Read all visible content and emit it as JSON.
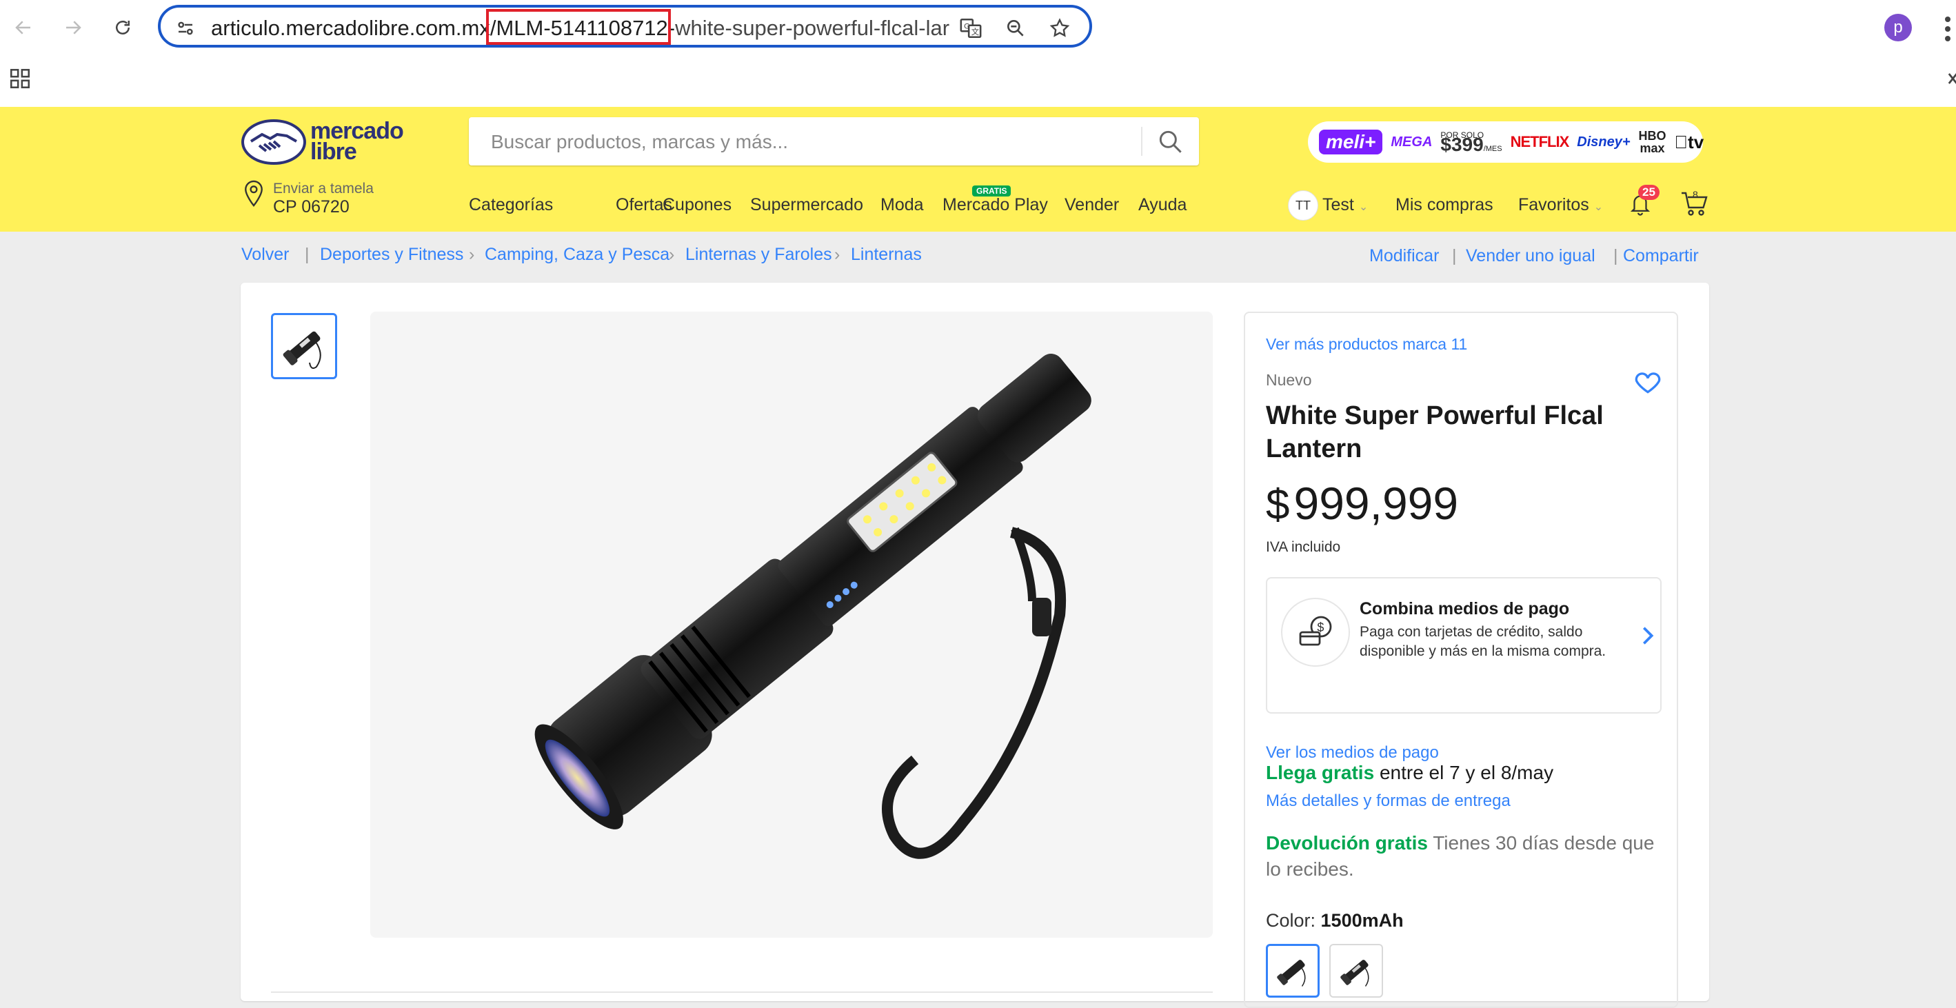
{
  "browser": {
    "url_domain": "articulo.mercadolibre.com.mx",
    "url_highlighted": "/MLM-5141108712-",
    "url_rest": "white-super-powerful-flcal-lar",
    "profile_initial": "p"
  },
  "header": {
    "logo_line1": "mercado",
    "logo_line2": "libre",
    "search_placeholder": "Buscar productos, marcas y más...",
    "promo": {
      "meli": "meli+",
      "mega": "MEGA",
      "por_solo": "POR SOLO",
      "price": "$399",
      "per": "/MES",
      "brands": [
        "NETFLIX",
        "Disney+",
        "HBO max",
        "tv"
      ]
    },
    "location_label": "Enviar a tamela",
    "location_value": "CP 06720",
    "nav": [
      "Categorías",
      "Ofertas",
      "Cupones",
      "Supermercado",
      "Moda",
      "Mercado Play",
      "Vender",
      "Ayuda"
    ],
    "gratis_badge": "GRATIS",
    "user_initials": "TT",
    "user_name": "Test",
    "my_purchases": "Mis compras",
    "favorites": "Favoritos",
    "notifications_count": "25",
    "cart_count": "8"
  },
  "breadcrumb": {
    "back": "Volver",
    "items": [
      "Deportes y Fitness",
      "Camping, Caza y Pesca",
      "Linternas y Faroles",
      "Linternas"
    ],
    "actions": [
      "Modificar",
      "Vender uno igual",
      "Compartir"
    ]
  },
  "product": {
    "brand_link": "Ver más productos marca 11",
    "condition": "Nuevo",
    "title": "White Super Powerful Flcal Lantern",
    "currency": "$",
    "price": "999,999",
    "tax": "IVA incluido",
    "payment": {
      "title": "Combina medios de pago",
      "subtitle": "Paga con tarjetas de crédito, saldo disponible y más en la misma compra."
    },
    "payment_link": "Ver los medios de pago",
    "shipping_green": "Llega gratis",
    "shipping_rest": " entre el 7 y el 8/may",
    "shipping_link": "Más detalles y formas de entrega",
    "return_green": "Devolución gratis",
    "return_rest": " Tienes 30 días desde que lo recibes.",
    "color_label": "Color: ",
    "color_value": "1500mAh"
  },
  "colors": {
    "accent": "#3483fa",
    "header_bg": "#fff159",
    "green": "#00a650",
    "badge_red": "#f23d4f",
    "url_highlight": "#e0202a"
  }
}
